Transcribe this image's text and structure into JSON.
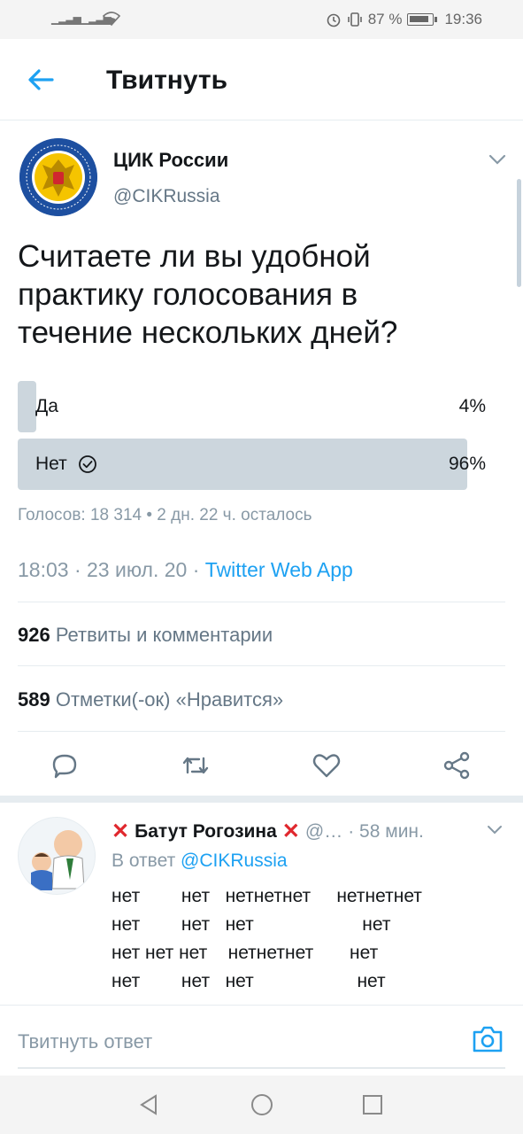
{
  "status_bar": {
    "battery": "87 %",
    "time": "19:36"
  },
  "header": {
    "title": "Твитнуть"
  },
  "tweet": {
    "author_name": "ЦИК России",
    "author_handle": "@CIKRussia",
    "text": "Считаете ли вы удобной практику голосования в течение нескольких дней?",
    "poll": {
      "options": [
        {
          "label": "Да",
          "percent": "4%",
          "fraction": 0.04,
          "selected": false
        },
        {
          "label": "Нет",
          "percent": "96%",
          "fraction": 0.96,
          "selected": true
        }
      ],
      "meta": "Голосов: 18 314 • 2 дн. 22 ч. осталось"
    },
    "timestamp": "18:03 · 23 июл. 20 · ",
    "source": "Twitter Web App",
    "retweets_count": "926",
    "retweets_label": "Ретвиты и комментарии",
    "likes_count": "589",
    "likes_label": "Отметки(-ок) «Нравится»"
  },
  "actions": [
    "reply-icon",
    "retweet-icon",
    "like-icon",
    "share-icon"
  ],
  "reply": {
    "name": "Батут Рогозина",
    "handle": "@…",
    "time": "· 58 мин.",
    "reply_to_prefix": "В ответ ",
    "reply_to_handle": "@CIKRussia",
    "text": "нет        нет   нетнетнет     нетнетнет\nнет        нет   нет                     нет\nнет нет нет    нетнетнет       нет\nнет        нет   нет                    нет"
  },
  "compose": {
    "placeholder": "Твитнуть ответ"
  },
  "colors": {
    "accent": "#1da1f2",
    "poll_fill": "#ccd6dd",
    "secondary_text": "#657786"
  }
}
